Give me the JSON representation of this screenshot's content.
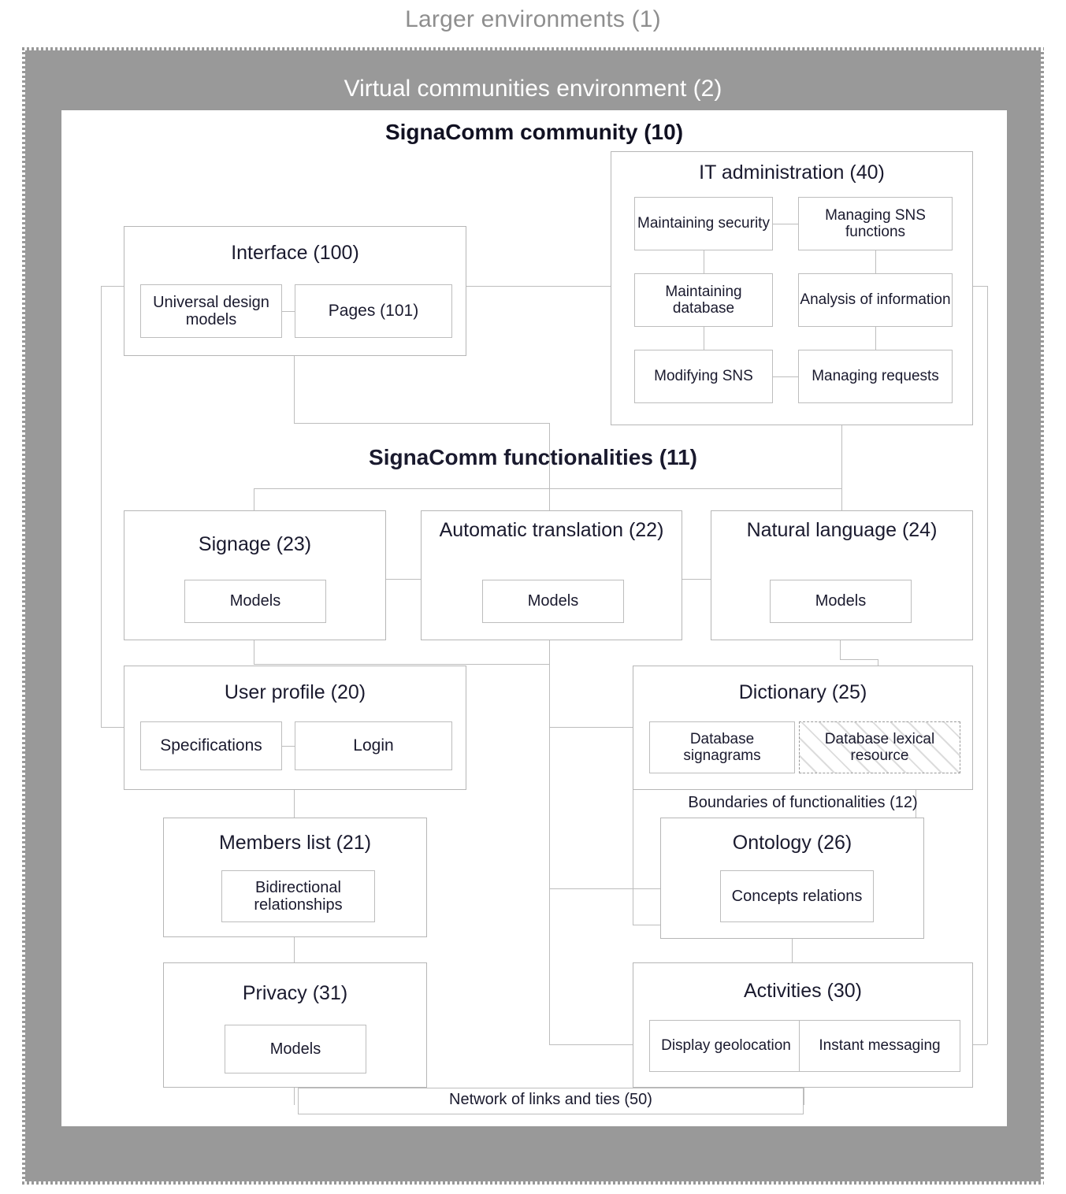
{
  "diagram": {
    "outer_label": "Larger environments (1)",
    "environment_label": "Virtual communities environment (2)",
    "community_label": "SignaComm community (10)",
    "functionalities_label": "SignaComm functionalities (11)",
    "boundaries_label": "Boundaries of  functionalities (12)",
    "network_label": "Network of links and ties (50)"
  },
  "colors": {
    "band": "#999999",
    "box_border": "#b6b6b6",
    "sub_border": "#bdbdbd",
    "connector": "#bdbdbd",
    "text": "#1a1a2e",
    "environment_text": "#ffffff",
    "outer_text": "#8e8e8e"
  },
  "nodes": {
    "it_administration": {
      "title": "IT administration (40)",
      "children": [
        "Maintaining security",
        "Managing SNS functions",
        "Maintaining database",
        "Analysis of information",
        "Modifying SNS",
        "Managing requests"
      ]
    },
    "interface": {
      "title": "Interface (100)",
      "children": [
        "Universal design models",
        "Pages (101)"
      ]
    },
    "signage": {
      "title": "Signage (23)",
      "children": [
        "Models"
      ]
    },
    "automatic_translation": {
      "title": "Automatic translation (22)",
      "children": [
        "Models"
      ]
    },
    "natural_language": {
      "title": "Natural language (24)",
      "children": [
        "Models"
      ]
    },
    "user_profile": {
      "title": "User profile (20)",
      "children": [
        "Specifications",
        "Login"
      ]
    },
    "dictionary": {
      "title": "Dictionary (25)",
      "children": [
        "Database signagrams",
        "Database lexical resource"
      ]
    },
    "members_list": {
      "title": "Members list (21)",
      "children": [
        "Bidirectional relationships"
      ]
    },
    "ontology": {
      "title": "Ontology (26)",
      "children": [
        "Concepts relations"
      ]
    },
    "privacy": {
      "title": "Privacy (31)",
      "children": [
        "Models"
      ]
    },
    "activities": {
      "title": "Activities (30)",
      "children": [
        "Display geolocation",
        "Instant messaging"
      ]
    }
  }
}
